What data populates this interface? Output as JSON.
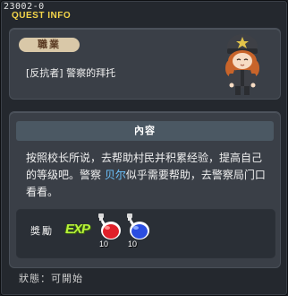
{
  "window": {
    "id_text": "23002-0",
    "title": "QUEST INFO"
  },
  "job": {
    "tag_label": "職業",
    "quest_name": "[反抗者] 警察的拜托"
  },
  "content": {
    "header": "內容",
    "description_before": "按照校长所说，去帮助村民并积累经验，提高自己的等级吧。警察 ",
    "npc_name": "贝尔",
    "description_after": "似乎需要帮助，去警察局门口看看。"
  },
  "reward": {
    "label": "獎勵",
    "exp_label": "EXP",
    "items": [
      {
        "icon": "red-potion-icon",
        "quantity": "10",
        "color": "#e0202a"
      },
      {
        "icon": "blue-potion-icon",
        "quantity": "10",
        "color": "#2a4de0"
      }
    ]
  },
  "status": {
    "text": "狀態：可開始"
  },
  "colors": {
    "title_accent": "#f5d64a",
    "npc_highlight": "#6cc4ff",
    "exp_green": "#b8f23a"
  }
}
